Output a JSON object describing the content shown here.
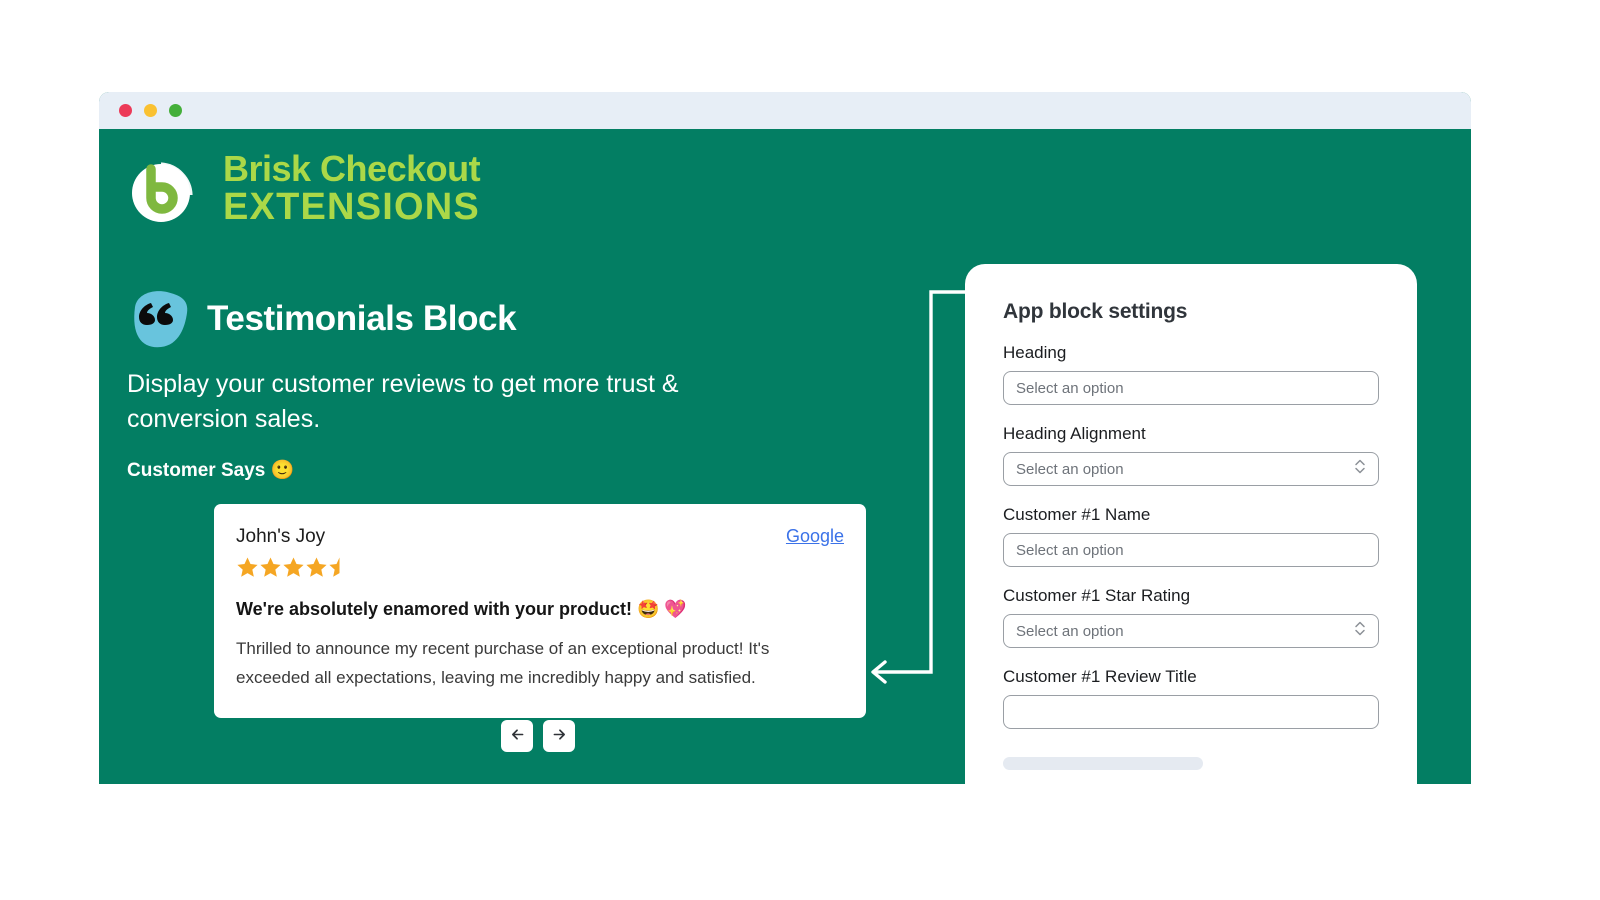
{
  "window": {
    "traffic_lights": [
      {
        "name": "close",
        "color": "#ec3a58"
      },
      {
        "name": "minimize",
        "color": "#fac131"
      },
      {
        "name": "maximize",
        "color": "#44af3a"
      }
    ],
    "background_color": "#037e63",
    "titlebar_color": "#e7eef6"
  },
  "brand": {
    "line1": "Brisk Checkout",
    "line2": "EXTENSIONS",
    "accent_color": "#abd848",
    "logo_icon": "brisk-b-logo-icon"
  },
  "hero": {
    "badge_icon": "quote-marks-icon",
    "title": "Testimonials Block",
    "subtitle": "Display your customer reviews to get more trust & conversion sales.",
    "kicker": "Customer Says 🙂"
  },
  "review": {
    "reviewer_name": "John's Joy",
    "source_label": "Google",
    "source_link_color": "#3b72e8",
    "rating": 4.5,
    "rating_max": 5,
    "star_color": "#f5a623",
    "title": "We're absolutely enamored with your product! 🤩 💖",
    "body": "Thrilled to announce my recent purchase of an exceptional product! It's exceeded all expectations, leaving me incredibly happy and satisfied."
  },
  "carousel": {
    "prev_icon": "arrow-left-icon",
    "prev_label": "←",
    "next_icon": "arrow-right-icon",
    "next_label": "→"
  },
  "settings": {
    "title": "App block settings",
    "fields": [
      {
        "label": "Heading",
        "value": "",
        "placeholder": "Select an option",
        "type": "text"
      },
      {
        "label": "Heading Alignment",
        "value": "",
        "placeholder": "Select an option",
        "type": "select"
      },
      {
        "label": "Customer #1 Name",
        "value": "",
        "placeholder": "Select an option",
        "type": "text"
      },
      {
        "label": "Customer #1 Star Rating",
        "value": "",
        "placeholder": "Select an option",
        "type": "select"
      },
      {
        "label": "Customer #1 Review Title",
        "value": "",
        "placeholder": "",
        "type": "text"
      }
    ],
    "skeleton_color": "#e5eaf1"
  },
  "connector": {
    "icon": "arrow-left-callout-icon",
    "color": "#ffffff"
  }
}
